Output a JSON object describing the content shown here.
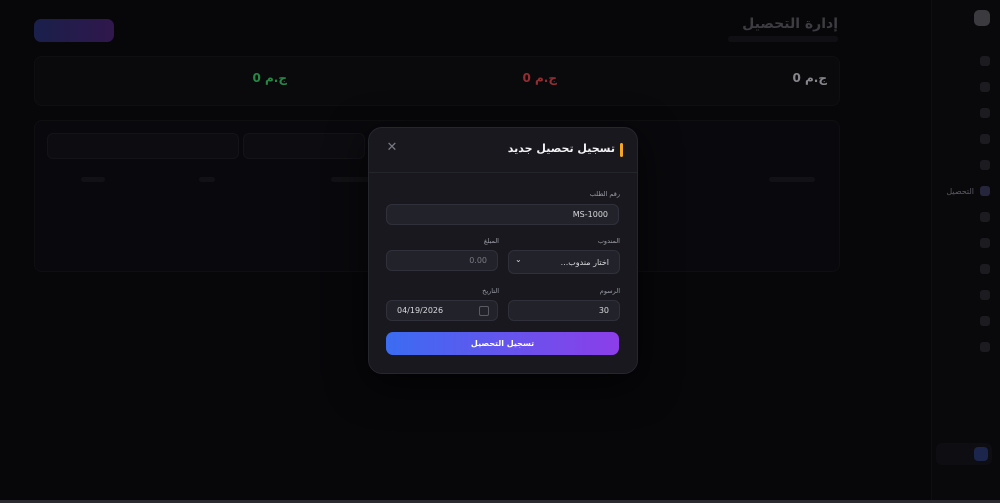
{
  "app": {
    "brand": "",
    "page_title": "إدارة التحصيل",
    "sidebar_items": [
      "",
      "",
      "",
      "",
      "",
      "",
      "التحصيل",
      "",
      "",
      "",
      "",
      "",
      ""
    ],
    "stats": [
      {
        "label": "",
        "value": "0 ج.م",
        "color": "#cfcfd6"
      },
      {
        "label": "",
        "value": "0 ج.م",
        "color": "#e0484f"
      },
      {
        "label": "",
        "value": "0 ج.م",
        "color": "#3ccf6a"
      }
    ]
  },
  "modal": {
    "title": "تسجيل تحصيل جديد",
    "close_icon": "close-icon",
    "order_no": {
      "label": "رقم الطلب",
      "value": "MS-1000"
    },
    "delegate": {
      "label": "المندوب",
      "placeholder": "اختار مندوب..."
    },
    "amount": {
      "label": "المبلغ",
      "placeholder": "0.00"
    },
    "fees": {
      "label": "الرسوم",
      "value": "30"
    },
    "date": {
      "label": "التاريخ",
      "value": "04/19/2026"
    },
    "submit_label": "تسجيل التحصيل"
  },
  "colors": {
    "accent": "#f5a623",
    "button_gradient_start": "#3b6cf2",
    "button_gradient_end": "#8c3ee9"
  }
}
